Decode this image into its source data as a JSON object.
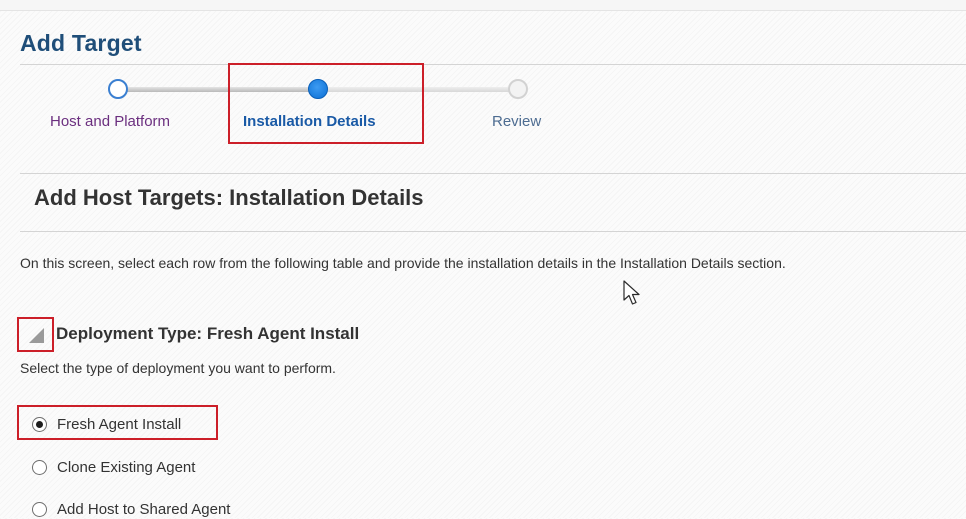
{
  "page": {
    "title": "Add Target"
  },
  "train": {
    "steps": [
      {
        "label": "Host and Platform",
        "state": "visited"
      },
      {
        "label": "Installation Details",
        "state": "current"
      },
      {
        "label": "Review",
        "state": "unvisited"
      }
    ]
  },
  "main": {
    "subtitle": "Add Host Targets: Installation Details",
    "instructions": "On this screen, select each row from the following table and provide the installation details in the Installation Details section."
  },
  "deployment": {
    "expanded": true,
    "title": "Deployment Type: Fresh Agent Install",
    "description": "Select the type of deployment you want to perform.",
    "options": [
      {
        "label": "Fresh Agent Install",
        "selected": true
      },
      {
        "label": "Clone Existing Agent",
        "selected": false
      },
      {
        "label": "Add Host to Shared Agent",
        "selected": false
      }
    ]
  },
  "colors": {
    "title": "#1f4e79",
    "current_step": "#1a5aa6",
    "highlight": "#cc1f29"
  },
  "icons": {
    "cursor": "mouse-pointer-icon",
    "toggle": "disclosure-triangle-icon"
  }
}
